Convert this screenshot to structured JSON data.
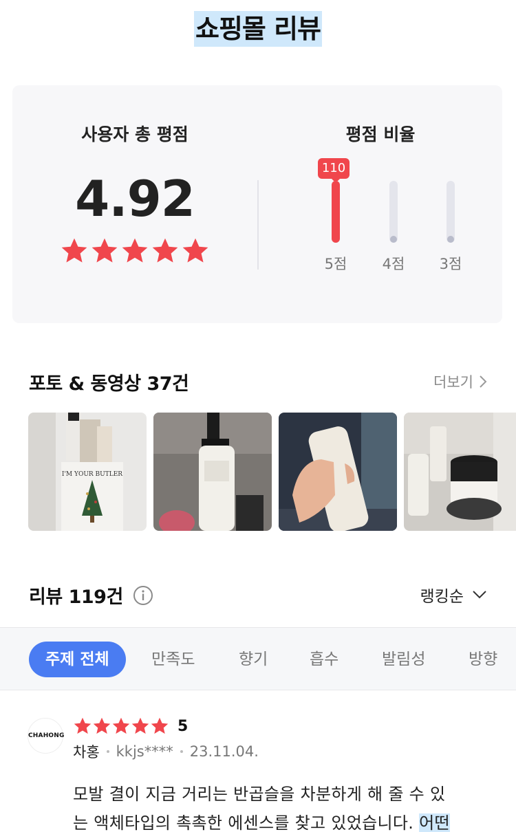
{
  "page": {
    "title": "쇼핑몰 리뷰"
  },
  "rating_summary": {
    "average_label": "사용자 총 평점",
    "average_score": "4.92",
    "average_stars": 5,
    "ratio_label": "평점 비율",
    "bars": [
      {
        "label": "5점",
        "count": "110",
        "fill": 1.0,
        "highlight": true
      },
      {
        "label": "4점",
        "count": "",
        "fill": 0.0,
        "highlight": false
      },
      {
        "label": "3점",
        "count": "",
        "fill": 0.0,
        "highlight": false
      }
    ],
    "colors": {
      "accent": "#f0464c",
      "track": "#e4e5ec"
    }
  },
  "photos": {
    "title": "포토 & 동영상 37건",
    "more_label": "더보기",
    "items": [
      {
        "name": "butler-essence-photo",
        "caption": "I'M YOUR BUTLER"
      },
      {
        "name": "bottle-photo-1",
        "caption": ""
      },
      {
        "name": "bottle-in-hand-photo",
        "caption": ""
      },
      {
        "name": "jars-photo",
        "caption": ""
      }
    ]
  },
  "reviews": {
    "title": "리뷰 119건",
    "sort_label": "랭킹순",
    "filters": [
      {
        "label": "주제 전체",
        "active": true
      },
      {
        "label": "만족도",
        "active": false
      },
      {
        "label": "향기",
        "active": false
      },
      {
        "label": "흡수",
        "active": false
      },
      {
        "label": "발림성",
        "active": false
      },
      {
        "label": "방향",
        "active": false
      }
    ],
    "items": [
      {
        "avatar_text": "CHAHONG",
        "stars": 5,
        "score": "5",
        "author": "차홍",
        "user_id": "kkjs****",
        "date": "23.11.04.",
        "body_line1": "모발 결이 지금 거리는 반곱슬을 차분하게 해 줄 수 있",
        "body_line2_a": "는 액체타입의 촉촉한 에센스를 찾고 있었습니다. ",
        "body_line2_b": "어떤"
      }
    ],
    "colors": {
      "active_chip": "#4a7cf2",
      "star": "#f0464c"
    }
  }
}
